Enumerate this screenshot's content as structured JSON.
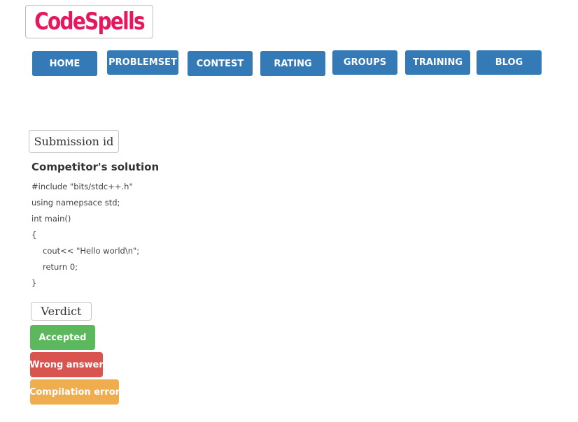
{
  "logo": {
    "text": "CodeSpells"
  },
  "nav": {
    "items": [
      {
        "label": "HOME"
      },
      {
        "label": "PROBLEMSET"
      },
      {
        "label": "CONTEST"
      },
      {
        "label": "RATING"
      },
      {
        "label": "GROUPS"
      },
      {
        "label": "TRAINING"
      },
      {
        "label": "BLOG"
      }
    ],
    "color": "#337ab7"
  },
  "submission": {
    "label": "Submission id"
  },
  "solution": {
    "title": "Competitor's solution",
    "code_lines": [
      "#include \"bits/stdc++.h\"",
      "using namepsace std;",
      "int main()",
      "{",
      "cout<< \"Hello world\\n\";",
      "return 0;",
      "}"
    ]
  },
  "verdict": {
    "label": "Verdict",
    "options": [
      {
        "label": "Accepted",
        "color": "#5cb85c"
      },
      {
        "label": "Wrong answer",
        "color": "#d9534f"
      },
      {
        "label": "Compilation error",
        "color": "#f0ad4e"
      }
    ]
  }
}
